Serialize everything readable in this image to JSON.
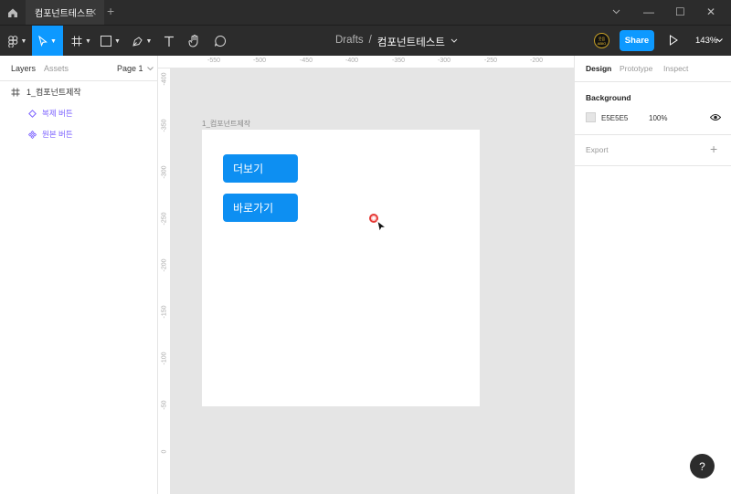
{
  "tabbar": {
    "active_tab": "컴포넌트테스트",
    "close_glyph": "✕",
    "add_glyph": "+",
    "win_min": "—",
    "win_max": "☐",
    "win_close": "✕"
  },
  "toolbar": {
    "crumb_drafts": "Drafts",
    "crumb_sep": "/",
    "crumb_file": "컴포넌트테스트",
    "crumb_caret": "⌄",
    "avatar_text": "웃음 ABIO",
    "share_label": "Share",
    "zoom_label": "143%"
  },
  "left_panel": {
    "tab_layers": "Layers",
    "tab_assets": "Assets",
    "page_label": "Page 1",
    "frame_layer": "1_컴포넌트제작",
    "component_layers": [
      "복제 버튼",
      "원본 버튼"
    ]
  },
  "rulers": {
    "top": [
      "-550",
      "-500",
      "-450",
      "-400",
      "-350",
      "-300",
      "-250",
      "-200"
    ],
    "left": [
      "-400",
      "-350",
      "-300",
      "-250",
      "-200",
      "-150",
      "-100",
      "-50",
      "0"
    ]
  },
  "canvas": {
    "frame_label": "1_컴포넌트제작",
    "buttons": [
      "더보기",
      "바로가기"
    ]
  },
  "right_panel": {
    "tab_design": "Design",
    "tab_prototype": "Prototype",
    "tab_inspect": "Inspect",
    "background_title": "Background",
    "background_hex": "E5E5E5",
    "background_opacity": "100%",
    "export_title": "Export",
    "export_plus": "+"
  },
  "help_label": "?",
  "colors": {
    "accent": "#0d99ff",
    "component": "#7b61ff",
    "button_fill": "#0d8ff2",
    "canvas_bg": "#e5e5e5",
    "chrome_bg": "#2c2c2c"
  }
}
